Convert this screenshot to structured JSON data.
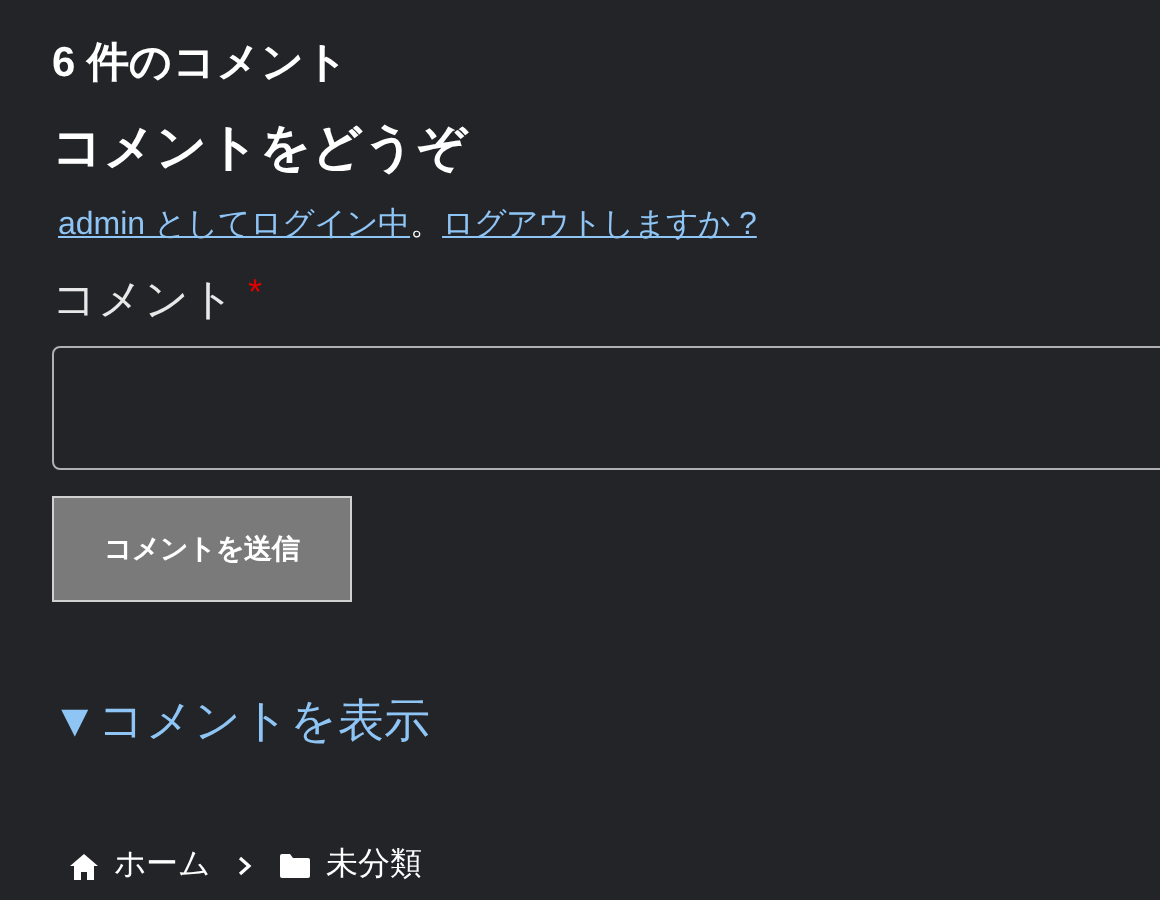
{
  "comments_title": "6 件のコメント",
  "reply_title": "コメントをどうぞ",
  "logged_in": {
    "account_link": "admin としてログイン中",
    "separator": "。",
    "logout_link": "ログアウトしますか ?"
  },
  "comment_field": {
    "label": "コメント",
    "required": true,
    "required_mark": "*"
  },
  "submit_button": "コメントを送信",
  "show_comments": "▼コメントを表示",
  "breadcrumb": [
    {
      "kind": "home",
      "label": "ホーム"
    },
    {
      "kind": "folder",
      "label": "未分類"
    }
  ]
}
